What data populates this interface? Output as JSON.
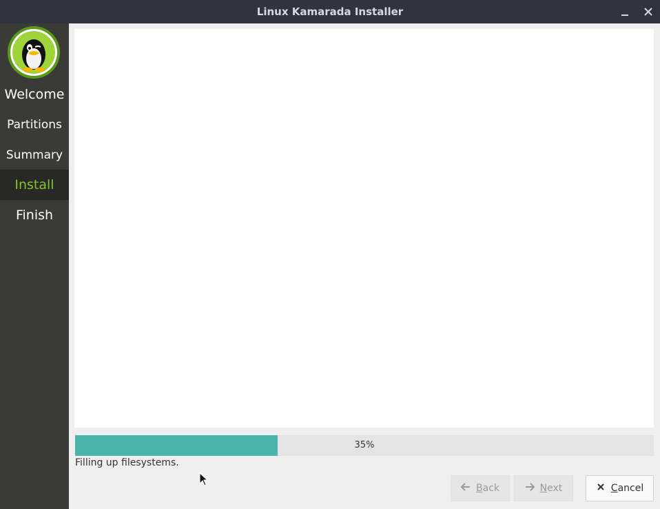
{
  "window": {
    "title": "Linux Kamarada Installer",
    "minimize_icon": "minimize-icon",
    "close_icon": "close-icon"
  },
  "sidebar": {
    "logo_icon": "tux-penguin-logo",
    "steps": [
      {
        "label": "Welcome",
        "active": false
      },
      {
        "label": "Partitions",
        "active": false
      },
      {
        "label": "Summary",
        "active": false
      },
      {
        "label": "Install",
        "active": true
      },
      {
        "label": "Finish",
        "active": false
      }
    ]
  },
  "main": {
    "progress": {
      "percent": 35,
      "label": "35%"
    },
    "status_text": "Filling up filesystems."
  },
  "buttons": {
    "back": {
      "mnemonic": "B",
      "rest": "ack",
      "enabled": false,
      "icon": "arrow-left-icon"
    },
    "next": {
      "mnemonic": "N",
      "rest": "ext",
      "enabled": false,
      "icon": "arrow-right-icon"
    },
    "cancel": {
      "mnemonic": "C",
      "rest": "ancel",
      "enabled": true,
      "icon": "x-icon"
    }
  },
  "colors": {
    "titlebar": "#2f343f",
    "sidebar": "#3a3a37",
    "sidebar_active": "#282827",
    "active_text": "#84c52a",
    "progress_fill": "#4cb5ab"
  }
}
